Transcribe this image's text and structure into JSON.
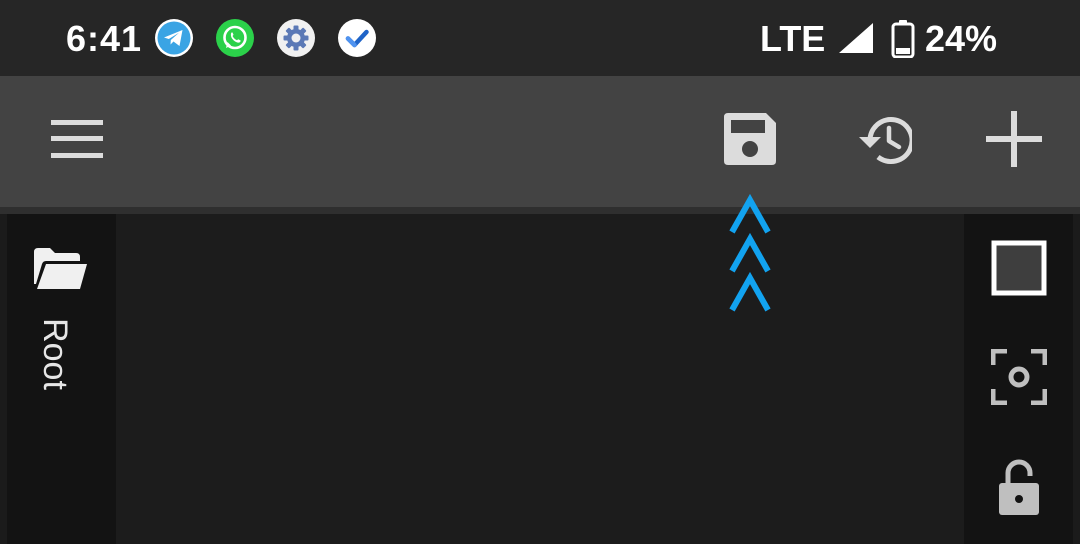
{
  "status_bar": {
    "time": "6:41",
    "network": "LTE",
    "battery_percent": "24%",
    "notification_icons": [
      "telegram-icon",
      "whatsapp-icon",
      "settings-gear-icon",
      "tasks-check-icon"
    ],
    "notification_colors": {
      "telegram": "#3aa4e4",
      "whatsapp": "#2bd14a",
      "settings": "#f1f1f1",
      "tasks": "#ffffff"
    }
  },
  "toolbar": {
    "icons": [
      "menu-icon",
      "save-icon",
      "history-icon",
      "add-icon"
    ],
    "icon_color": "#dcdcdc",
    "background": "#434343"
  },
  "left_panel": {
    "folder_label": "Root",
    "icon": "folder-open-icon"
  },
  "hint": {
    "icon": "triple-chevron-up-icon",
    "color": "#12a3f0"
  },
  "right_panel": {
    "icons": [
      "square-icon",
      "focus-capture-icon",
      "lock-icon"
    ]
  }
}
